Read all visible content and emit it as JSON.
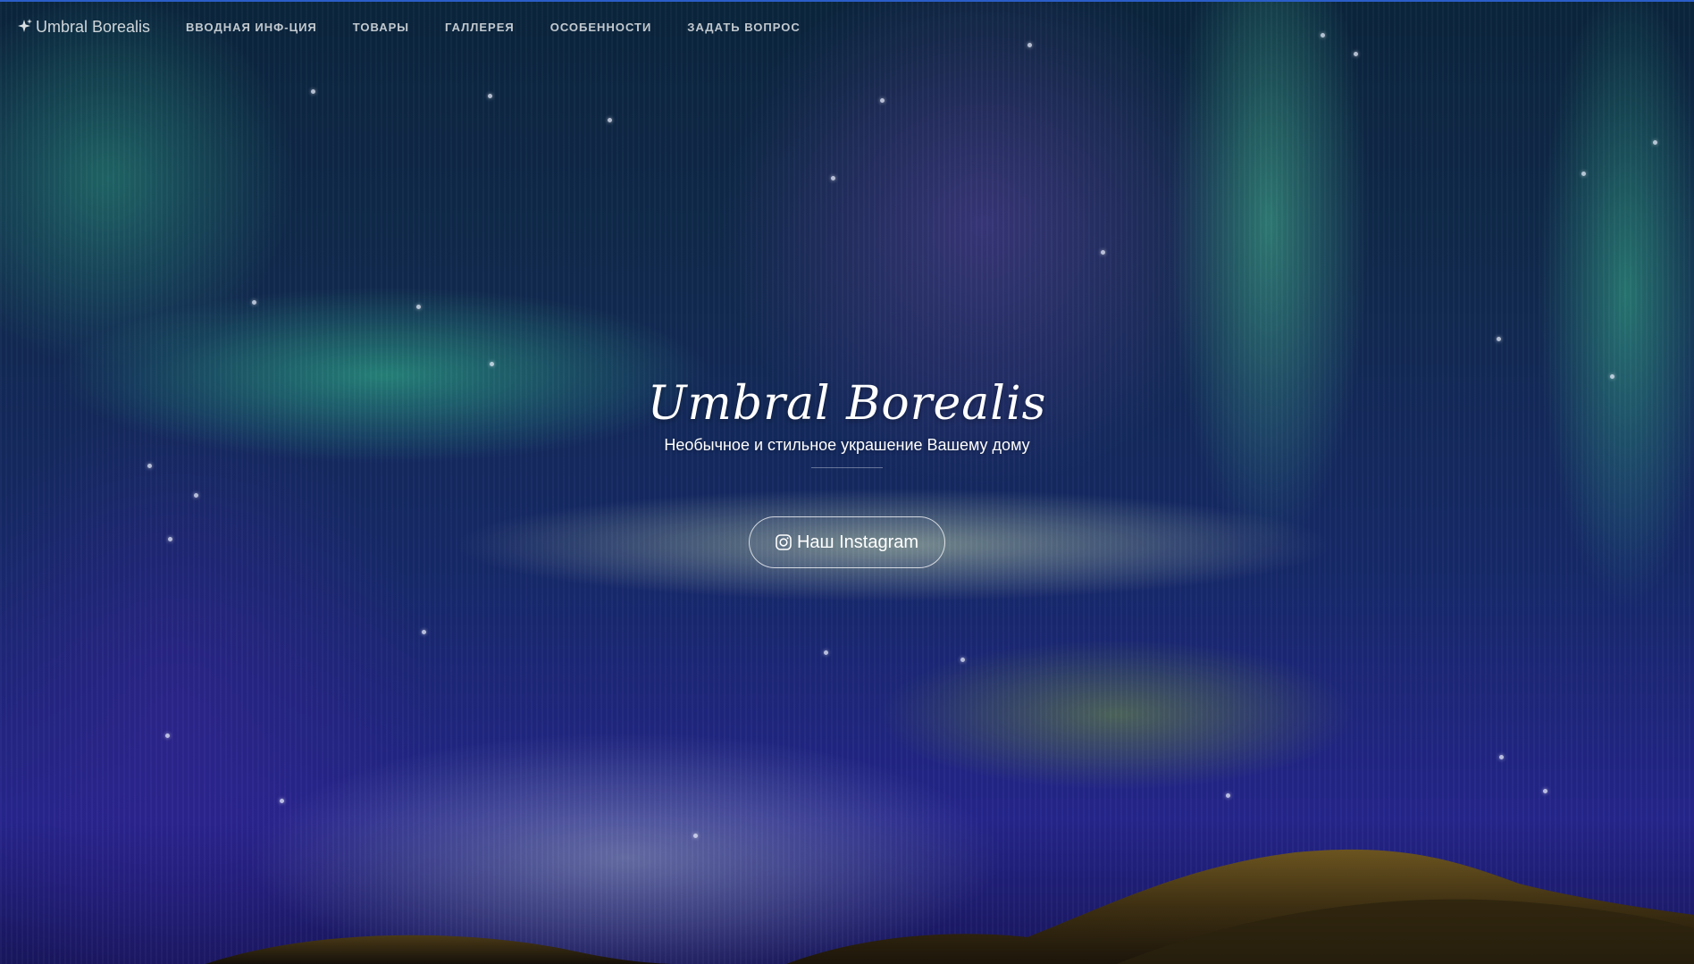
{
  "navbar": {
    "brand": {
      "label": "Umbral Borealis",
      "icon": "sparkle-icon"
    },
    "items": [
      {
        "label": "ВВОДНАЯ ИНФ-ЦИЯ"
      },
      {
        "label": "ТОВАРЫ"
      },
      {
        "label": "ГАЛЛЕРЕЯ"
      },
      {
        "label": "ОСОБЕННОСТИ"
      },
      {
        "label": "ЗАДАТЬ ВОПРОС"
      }
    ]
  },
  "hero": {
    "title": "Umbral Borealis",
    "subtitle": "Необычное и стильное украшение Вашему дому",
    "button": {
      "label": "Наш Instagram",
      "icon": "instagram-icon"
    }
  },
  "colors": {
    "nav_border": "#2a5ec8",
    "text": "#ffffff"
  }
}
